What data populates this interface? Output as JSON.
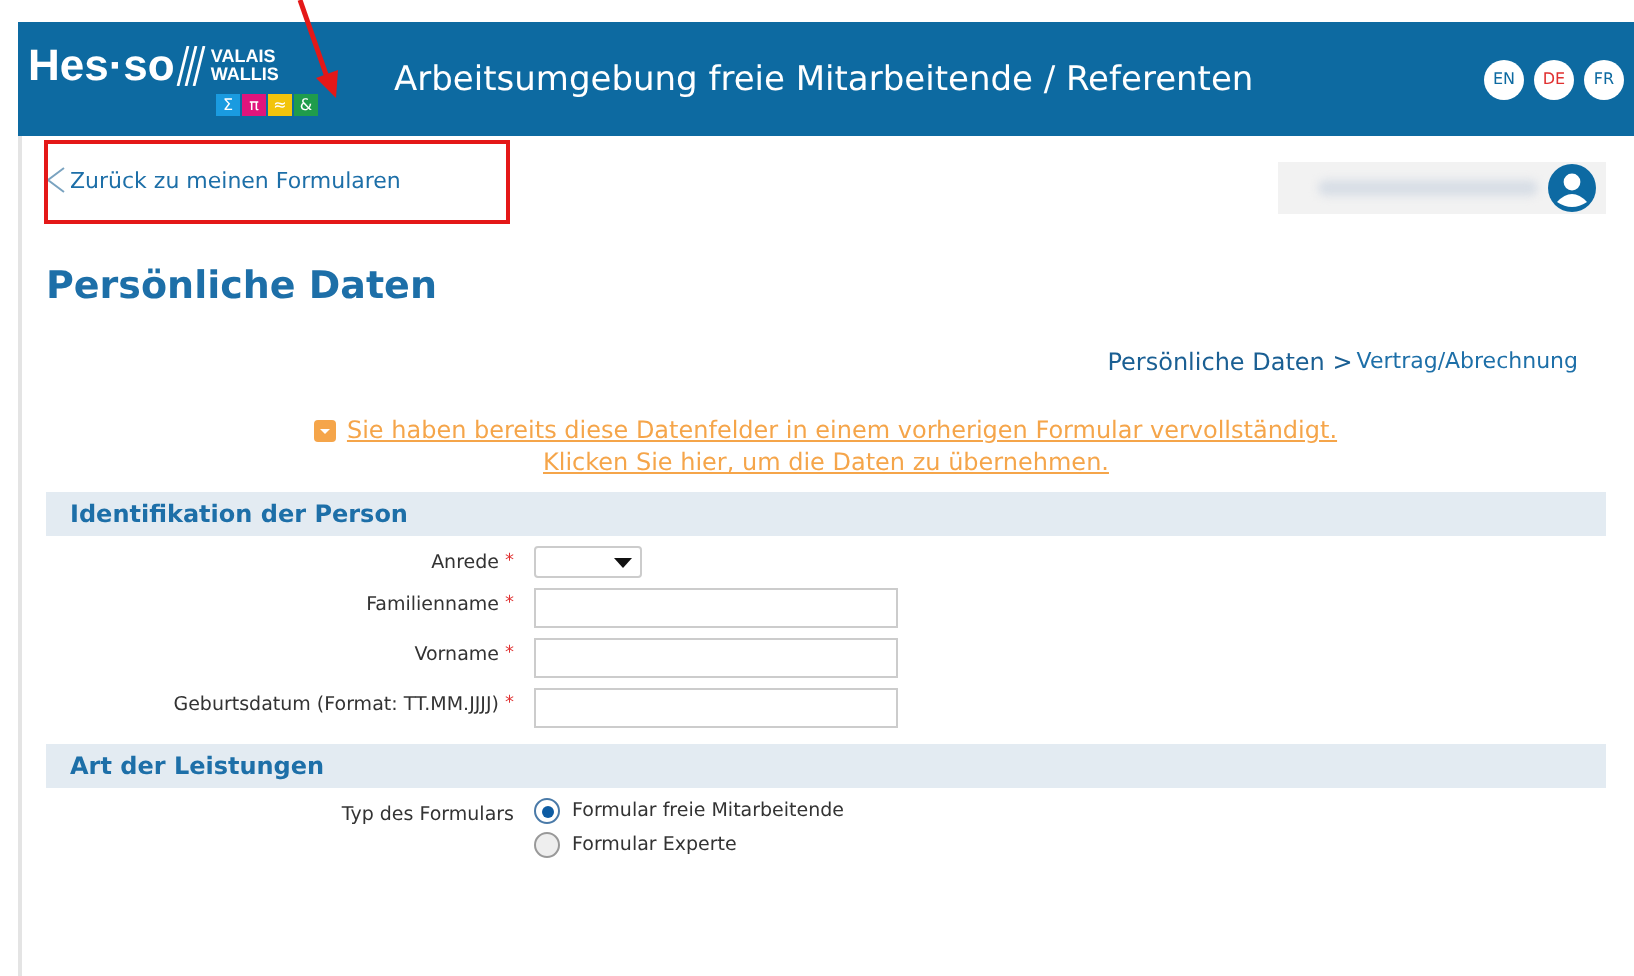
{
  "header": {
    "logo": {
      "word": "Hes·so",
      "region_lines": [
        "VALAIS",
        "WALLIS"
      ],
      "tiles": [
        {
          "glyph": "Σ",
          "color": "#1a9be0"
        },
        {
          "glyph": "π",
          "color": "#e0147c"
        },
        {
          "glyph": "≈",
          "color": "#f2c40c"
        },
        {
          "glyph": "&",
          "color": "#1f9c4c"
        }
      ]
    },
    "title": "Arbeitsumgebung freie Mitarbeitende / Referenten",
    "languages": [
      {
        "label": "EN",
        "selected": false
      },
      {
        "label": "DE",
        "selected": true
      },
      {
        "label": "FR",
        "selected": false
      }
    ]
  },
  "back_link": "Zurück zu meinen Formularen",
  "page_title": "Persönliche Daten",
  "breadcrumb": [
    {
      "label": "Persönliche Daten >",
      "selected": true
    },
    {
      "label": "Vertrag/Abrechnung",
      "selected": false
    }
  ],
  "notice": {
    "lines": [
      "Sie haben bereits diese Datenfelder in einem vorherigen Formular vervollständigt.",
      "Klicken Sie hier, um die Daten zu übernehmen."
    ]
  },
  "sections": [
    {
      "title": "Identifikation der Person",
      "fields": [
        {
          "kind": "select",
          "label": "Anrede",
          "required_mark": "*"
        },
        {
          "kind": "text",
          "label": "Familienname",
          "required_mark": "*"
        },
        {
          "kind": "text",
          "label": "Vorname",
          "required_mark": "*"
        },
        {
          "kind": "text",
          "label": "Geburtsdatum (Format: TT.MM.JJJJ)",
          "required_mark": "*"
        }
      ]
    },
    {
      "title": "Art der Leistungen",
      "fields": [
        {
          "kind": "radio",
          "label": "Typ des Formulars",
          "options": [
            {
              "label": "Formular freie Mitarbeitende",
              "selected": true
            },
            {
              "label": "Formular Experte",
              "selected": false
            }
          ]
        }
      ]
    }
  ]
}
